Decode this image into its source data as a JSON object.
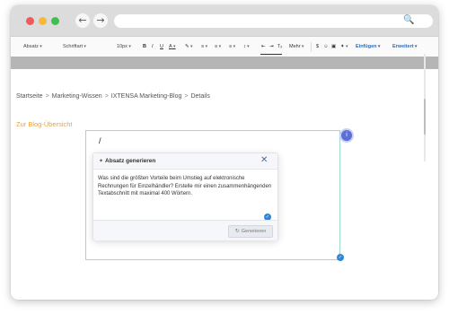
{
  "browser": {
    "title_dots": {
      "red": "#ef5b5b",
      "yellow": "#f5b83a",
      "green": "#3fbf4f"
    },
    "back_icon": "arrow-left-icon",
    "forward_icon": "arrow-right-icon",
    "search_icon": "magnifier-icon"
  },
  "toolbar": {
    "paragraph_select": "Absatz",
    "font_select": "Schriftart",
    "size_select": "10px",
    "bold": "B",
    "italic": "I",
    "underline": "U",
    "color": "A",
    "more": "Mehr",
    "insert": "Einfügen",
    "advanced": "Erweitert"
  },
  "breadcrumb": {
    "items": [
      "Startseite",
      "Marketing-Wissen",
      "IXTENSA Marketing-Blog",
      "Details"
    ],
    "separator": ">"
  },
  "back_link": "Zur Blog-Übersicht",
  "editor": {
    "slash": "/",
    "info_badge": "i"
  },
  "dialog": {
    "title": "Absatz generieren",
    "prompt": "Was sind die größten Vorteile beim Umstieg auf elektronische Rechnungen für Einzelhändler? Erstelle mir einen zusammenhängenden Textabschnitt mit maximal 400 Wörtern.",
    "generate_label": "Generieren"
  },
  "colors": {
    "accent_orange": "#f0a030",
    "accent_blue": "#2f86d8",
    "info_purple": "#5b6fd6",
    "editor_border": "#9fd7c9"
  }
}
